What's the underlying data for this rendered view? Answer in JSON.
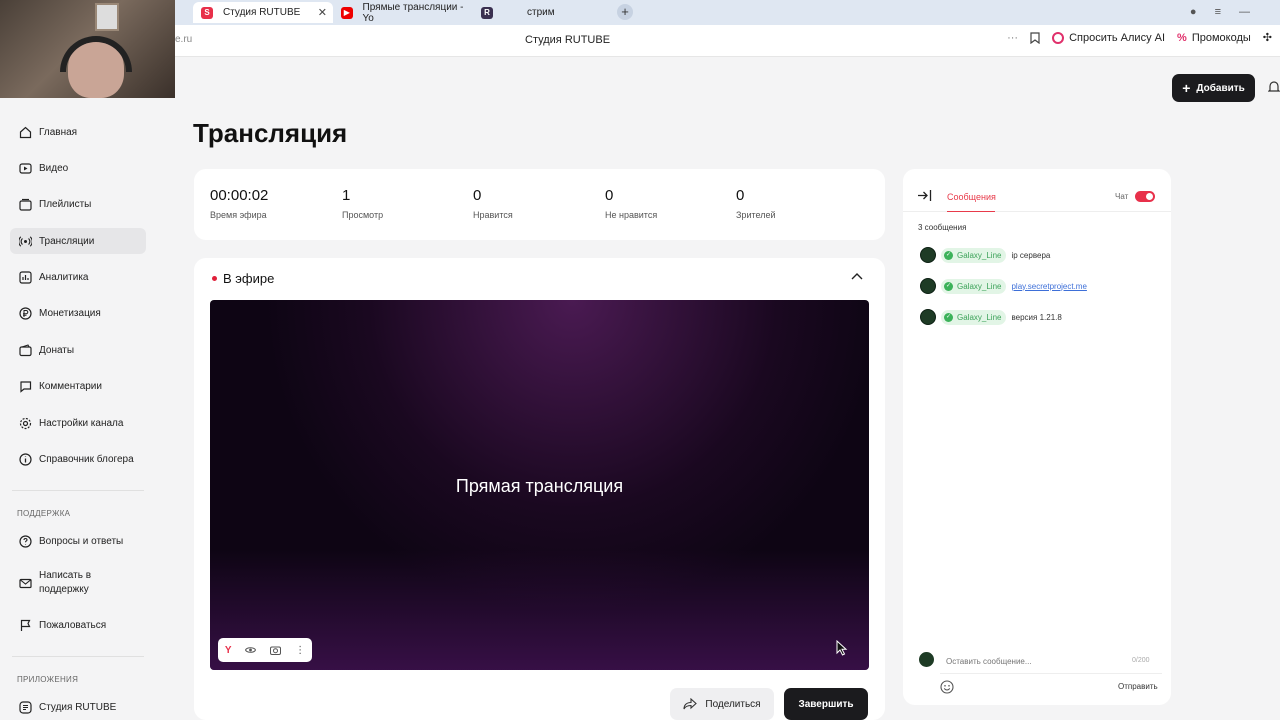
{
  "browser": {
    "tabs": [
      {
        "label": "Студия RUTUBE",
        "active": true
      },
      {
        "label": "Прямые трансляции - Yo",
        "active": false
      },
      {
        "label": "стрим",
        "active": false
      }
    ],
    "url": "e.ru",
    "page_title": "Студия RUTUBE",
    "alice_label": "Спросить Алису AI",
    "promo_label": "Промокоды"
  },
  "header": {
    "add_label": "Добавить"
  },
  "sidebar": {
    "items": [
      {
        "label": "Главная",
        "icon": "home-icon"
      },
      {
        "label": "Видео",
        "icon": "video-icon"
      },
      {
        "label": "Плейлисты",
        "icon": "playlist-icon"
      },
      {
        "label": "Трансляции",
        "icon": "broadcast-icon"
      },
      {
        "label": "Аналитика",
        "icon": "analytics-icon"
      },
      {
        "label": "Монетизация",
        "icon": "ruble-icon"
      },
      {
        "label": "Донаты",
        "icon": "wallet-icon"
      },
      {
        "label": "Комментарии",
        "icon": "comment-icon"
      },
      {
        "label": "Настройки канала",
        "icon": "gear-icon"
      },
      {
        "label": "Справочник блогера",
        "icon": "info-icon"
      }
    ],
    "support_title": "ПОДДЕРЖКА",
    "support_items": [
      {
        "label": "Вопросы и ответы",
        "icon": "question-icon"
      },
      {
        "label": "Написать в поддержку",
        "icon": "mail-icon"
      },
      {
        "label": "Пожаловаться",
        "icon": "flag-icon"
      }
    ],
    "apps_title": "ПРИЛОЖЕНИЯ",
    "apps_items": [
      {
        "label": "Студия RUTUBE",
        "icon": "app-icon"
      }
    ]
  },
  "main": {
    "title": "Трансляция",
    "stats": [
      {
        "value": "00:00:02",
        "label": "Время эфира"
      },
      {
        "value": "1",
        "label": "Просмотр"
      },
      {
        "value": "0",
        "label": "Нравится"
      },
      {
        "value": "0",
        "label": "Не нравится"
      },
      {
        "value": "0",
        "label": "Зрителей"
      }
    ],
    "live_label": "В эфире",
    "player_text": "Прямая трансляция",
    "share_label": "Поделиться",
    "end_label": "Завершить"
  },
  "chat": {
    "tab_label": "Сообщения",
    "toggle_label": "Чат",
    "count_label": "3 сообщения",
    "messages": [
      {
        "author": "Galaxy_Line",
        "text": "ip сервера",
        "is_link": false
      },
      {
        "author": "Galaxy_Line",
        "text": "play.secretproject.me",
        "is_link": true
      },
      {
        "author": "Galaxy_Line",
        "text": "версия 1.21.8",
        "is_link": false
      }
    ],
    "input_placeholder": "Оставить сообщение...",
    "counter": "0/200",
    "send_label": "Отправить"
  },
  "colors": {
    "accent_red": "#e83a4a",
    "dark_button": "#1b1b1e",
    "verified_green": "#3cb25a"
  }
}
